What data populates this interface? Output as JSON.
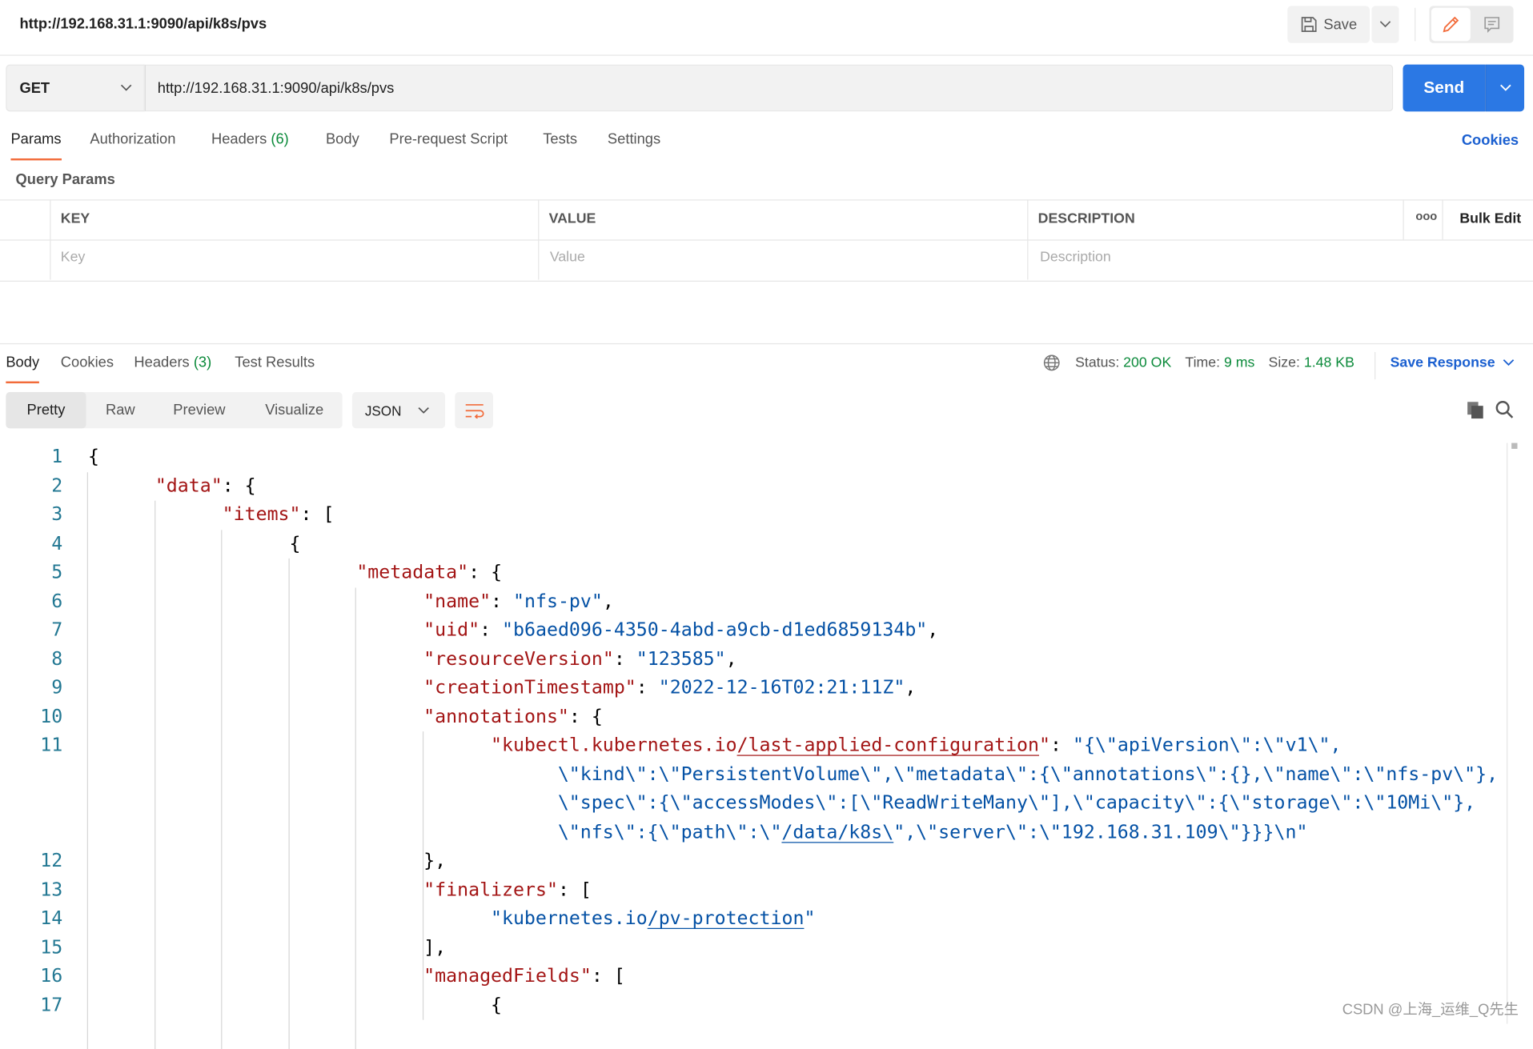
{
  "header": {
    "title": "http://192.168.31.1:9090/api/k8s/pvs",
    "save_label": "Save"
  },
  "request": {
    "method": "GET",
    "url": "http://192.168.31.1:9090/api/k8s/pvs",
    "send_label": "Send"
  },
  "request_tabs": [
    {
      "label": "Params",
      "active": true
    },
    {
      "label": "Authorization"
    },
    {
      "label": "Headers",
      "count": "(6)"
    },
    {
      "label": "Body"
    },
    {
      "label": "Pre-request Script"
    },
    {
      "label": "Tests"
    },
    {
      "label": "Settings"
    }
  ],
  "cookies_link": "Cookies",
  "query_params": {
    "title": "Query Params",
    "columns": [
      "KEY",
      "VALUE",
      "DESCRIPTION"
    ],
    "more": "ooo",
    "bulk_edit": "Bulk Edit",
    "placeholders": {
      "key": "Key",
      "value": "Value",
      "description": "Description"
    }
  },
  "response_tabs": [
    {
      "label": "Body",
      "active": true
    },
    {
      "label": "Cookies"
    },
    {
      "label": "Headers",
      "count": "(3)"
    },
    {
      "label": "Test Results"
    }
  ],
  "status": {
    "status_label": "Status:",
    "status_value": "200 OK",
    "time_label": "Time:",
    "time_value": "9 ms",
    "size_label": "Size:",
    "size_value": "1.48 KB",
    "save_response": "Save Response"
  },
  "view_modes": [
    "Pretty",
    "Raw",
    "Preview",
    "Visualize"
  ],
  "format": "JSON",
  "colors": {
    "accent": "#2b78e4",
    "active_tab": "#f26b3a",
    "ok": "#0b8a3a",
    "json_key": "#a31515",
    "json_string": "#0451a5"
  },
  "code_lines": [
    {
      "n": "1",
      "lvl": 0,
      "tok": [
        [
          "p",
          "{"
        ]
      ]
    },
    {
      "n": "2",
      "lvl": 1,
      "tok": [
        [
          "k",
          "\"data\""
        ],
        [
          "p",
          ": {"
        ]
      ]
    },
    {
      "n": "3",
      "lvl": 2,
      "tok": [
        [
          "k",
          "\"items\""
        ],
        [
          "p",
          ": ["
        ]
      ]
    },
    {
      "n": "4",
      "lvl": 3,
      "tok": [
        [
          "p",
          "{"
        ]
      ]
    },
    {
      "n": "5",
      "lvl": 4,
      "tok": [
        [
          "k",
          "\"metadata\""
        ],
        [
          "p",
          ": {"
        ]
      ]
    },
    {
      "n": "6",
      "lvl": 5,
      "tok": [
        [
          "k",
          "\"name\""
        ],
        [
          "p",
          ": "
        ],
        [
          "s",
          "\"nfs-pv\""
        ],
        [
          "p",
          ","
        ]
      ]
    },
    {
      "n": "7",
      "lvl": 5,
      "tok": [
        [
          "k",
          "\"uid\""
        ],
        [
          "p",
          ": "
        ],
        [
          "s",
          "\"b6aed096-4350-4abd-a9cb-d1ed6859134b\""
        ],
        [
          "p",
          ","
        ]
      ]
    },
    {
      "n": "8",
      "lvl": 5,
      "tok": [
        [
          "k",
          "\"resourceVersion\""
        ],
        [
          "p",
          ": "
        ],
        [
          "s",
          "\"123585\""
        ],
        [
          "p",
          ","
        ]
      ]
    },
    {
      "n": "9",
      "lvl": 5,
      "tok": [
        [
          "k",
          "\"creationTimestamp\""
        ],
        [
          "p",
          ": "
        ],
        [
          "s",
          "\"2022-12-16T02:21:11Z\""
        ],
        [
          "p",
          ","
        ]
      ]
    },
    {
      "n": "10",
      "lvl": 5,
      "tok": [
        [
          "k",
          "\"annotations\""
        ],
        [
          "p",
          ": {"
        ]
      ]
    },
    {
      "n": "11",
      "lvl": 6,
      "tok": [
        [
          "k",
          "\"kubectl.kubernetes.io"
        ],
        [
          "ku",
          "/last-applied-configuration"
        ],
        [
          "k",
          "\""
        ],
        [
          "p",
          ": "
        ],
        [
          "s",
          "\"{\\\"apiVersion\\\":\\\"v1\\\","
        ]
      ]
    },
    {
      "n": "",
      "lvl": 7,
      "tok": [
        [
          "s",
          "\\\"kind\\\":\\\"PersistentVolume\\\",\\\"metadata\\\":{\\\"annotations\\\":{},\\\"name\\\":\\\"nfs-pv\\\"},"
        ]
      ]
    },
    {
      "n": "",
      "lvl": 7,
      "tok": [
        [
          "s",
          "\\\"spec\\\":{\\\"accessModes\\\":[\\\"ReadWriteMany\\\"],\\\"capacity\\\":{\\\"storage\\\":\\\"10Mi\\\"},"
        ]
      ]
    },
    {
      "n": "",
      "lvl": 7,
      "tok": [
        [
          "s",
          "\\\"nfs\\\":{\\\"path\\\":\\\""
        ],
        [
          "su",
          "/data/k8s\\"
        ],
        [
          "s",
          "\",\\\"server\\\":\\\"192.168.31.109\\\"}}}\\n\""
        ]
      ]
    },
    {
      "n": "12",
      "lvl": 5,
      "tok": [
        [
          "p",
          "},"
        ]
      ]
    },
    {
      "n": "13",
      "lvl": 5,
      "tok": [
        [
          "k",
          "\"finalizers\""
        ],
        [
          "p",
          ": ["
        ]
      ]
    },
    {
      "n": "14",
      "lvl": 6,
      "tok": [
        [
          "s",
          "\"kubernetes.io"
        ],
        [
          "su",
          "/pv-protection"
        ],
        [
          "s",
          "\""
        ]
      ]
    },
    {
      "n": "15",
      "lvl": 5,
      "tok": [
        [
          "p",
          "],"
        ]
      ]
    },
    {
      "n": "16",
      "lvl": 5,
      "tok": [
        [
          "k",
          "\"managedFields\""
        ],
        [
          "p",
          ": ["
        ]
      ]
    },
    {
      "n": "17",
      "lvl": 6,
      "tok": [
        [
          "p",
          "{"
        ]
      ]
    }
  ],
  "watermark": "CSDN @上海_运维_Q先生"
}
